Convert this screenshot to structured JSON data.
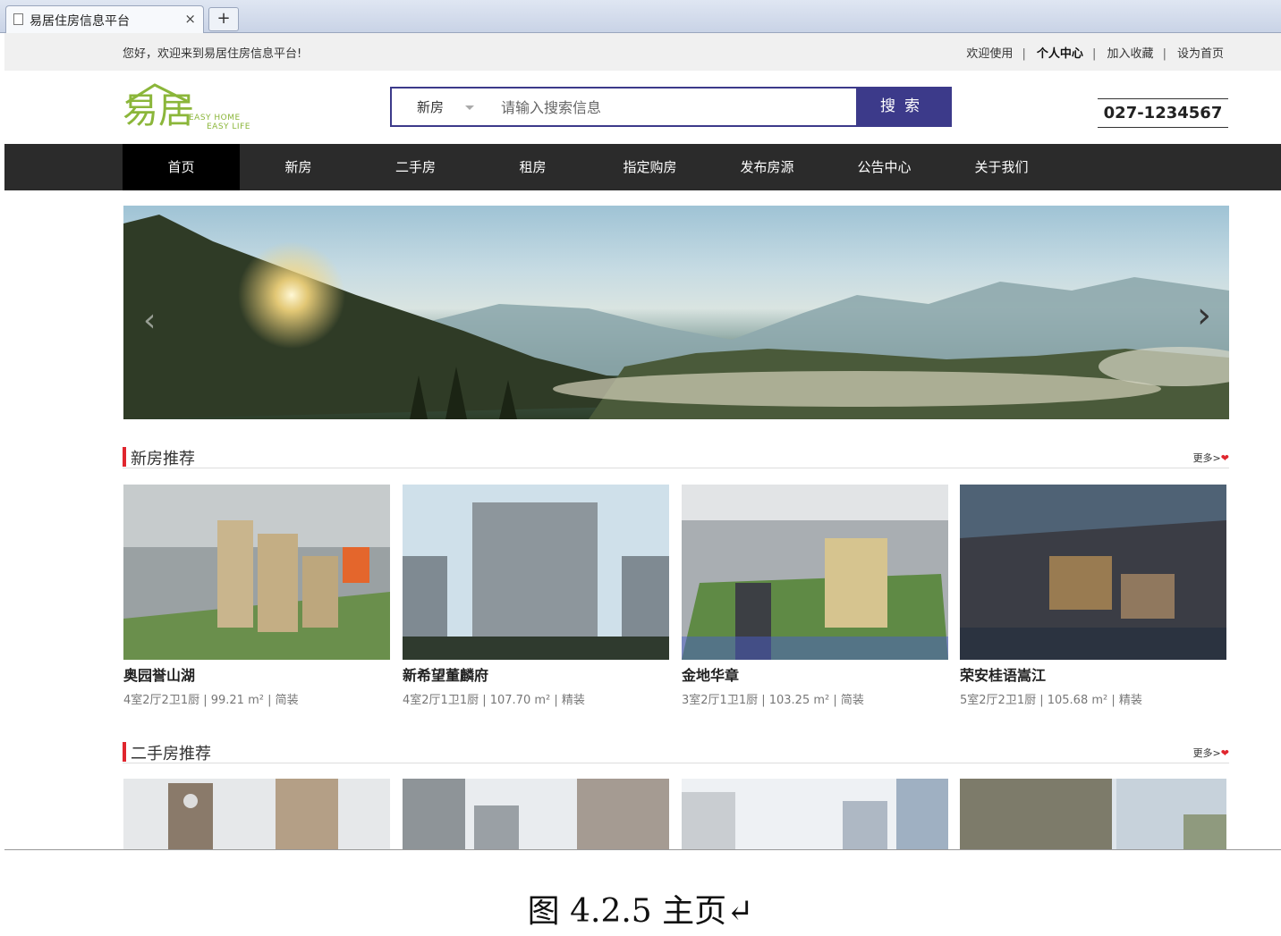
{
  "browser": {
    "tab_title": "易居住房信息平台",
    "tab_close": "×",
    "new_tab": "+"
  },
  "topbar": {
    "welcome": "您好，欢迎来到易居住房信息平台!",
    "links": [
      "欢迎使用",
      "个人中心",
      "加入收藏",
      "设为首页"
    ]
  },
  "header": {
    "logo_cn": "易居",
    "logo_en1": "EASY HOME",
    "logo_en2": "EASY LIFE",
    "search_type": "新房",
    "search_placeholder": "请输入搜索信息",
    "search_button": "搜索",
    "phone": "027-1234567"
  },
  "nav": {
    "items": [
      "首页",
      "新房",
      "二手房",
      "租房",
      "指定购房",
      "发布房源",
      "公告中心",
      "关于我们"
    ],
    "active_index": 0
  },
  "sections": {
    "new_houses": {
      "title": "新房推荐",
      "more": "更多>",
      "cards": [
        {
          "name": "奥园誉山湖",
          "info": "4室2厅2卫1厨 | 99.21 m² | 简装"
        },
        {
          "name": "新希望董麟府",
          "info": "4室2厅1卫1厨 | 107.70 m² | 精装"
        },
        {
          "name": "金地华章",
          "info": "3室2厅1卫1厨 | 103.25 m² | 简装"
        },
        {
          "name": "荣安桂语嵩江",
          "info": "5室2厅2卫1厨 | 105.68 m² | 精装"
        }
      ]
    },
    "second_hand": {
      "title": "二手房推荐",
      "more": "更多>"
    }
  },
  "caption": "图 4.2.5    主页↵",
  "colors": {
    "accent": "#3c3a8a",
    "nav_bg": "#2b2b2b",
    "section_bar": "#e0262e",
    "logo_green": "#8bb63a"
  }
}
